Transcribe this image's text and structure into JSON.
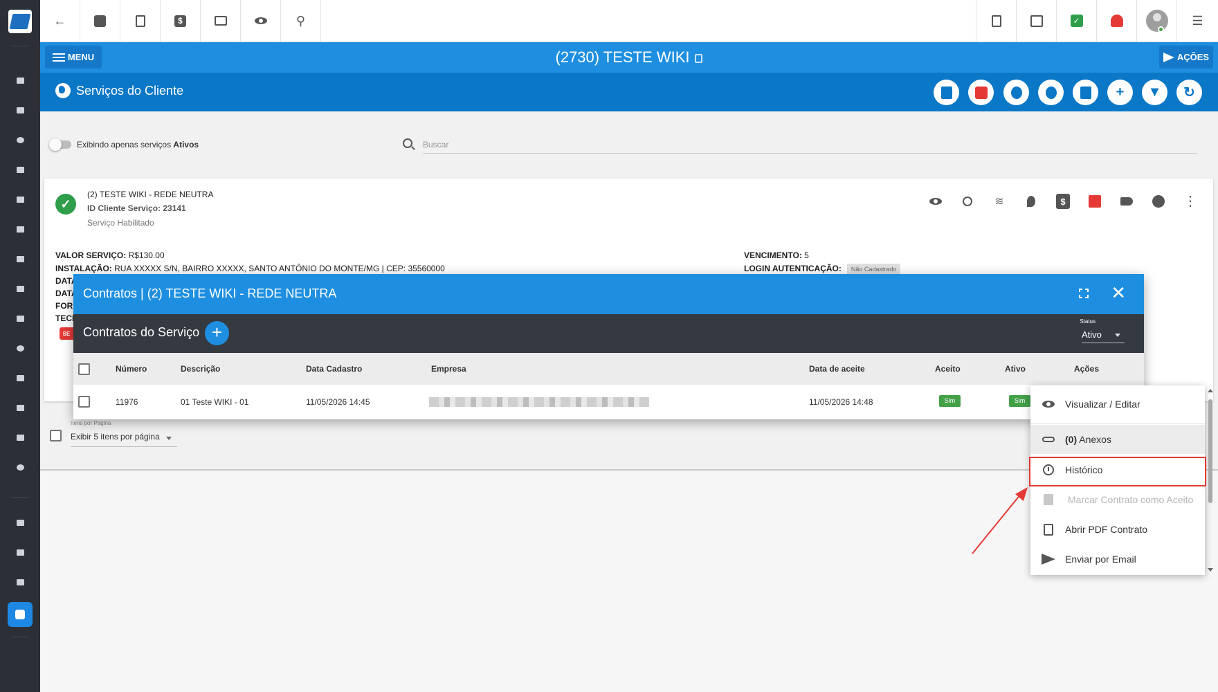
{
  "colors": {
    "sidebar_bg": "#2c3036",
    "primary_blue": "#1e8fe0",
    "dark_blue": "#0a77c7",
    "modal_subheader": "#353a41",
    "success_green": "#43a047",
    "alert_red": "#e53935"
  },
  "sidebar": {
    "icons": [
      "logo-icon",
      "dashboard-icon",
      "flag-icon",
      "chart-icon",
      "contact-icon",
      "book-icon",
      "calendar-icon",
      "briefcase-icon",
      "box-icon",
      "card-icon",
      "map-pin-icon",
      "list-icon",
      "stack-icon",
      "document-icon",
      "gear-icon",
      "youtube-icon",
      "wiki-icon",
      "chat-icon",
      "puzzle-icon"
    ]
  },
  "topbar": {
    "left_icons": [
      "back-arrow-icon",
      "contact-card-icon",
      "calendar-clock-icon",
      "dollar-icon",
      "terminal-icon",
      "eye-icon",
      "search-icon"
    ],
    "right_icons": [
      "pdf-icon",
      "calendar-badge-icon",
      "check-badge-icon",
      "alarm-icon",
      "avatar",
      "list-icon"
    ]
  },
  "header": {
    "menu_label": "MENU",
    "client_title": "(2730) TESTE WIKI",
    "actions_label": "AÇÕES"
  },
  "subheader": {
    "title": "Serviços do Cliente",
    "buttons": [
      "gift-icon",
      "alert-icon",
      "calendar-clock-icon",
      "list-icon",
      "document-icon",
      "add-icon",
      "filter-icon",
      "refresh-icon"
    ]
  },
  "filter": {
    "toggle_label_prefix": "Exibindo apenas serviços ",
    "toggle_label_bold": "Ativos",
    "search_placeholder": "Buscar"
  },
  "service": {
    "name": "(2) TESTE WIKI - REDE NEUTRA",
    "id_line": "ID Cliente Serviço: 23141",
    "status": "Serviço Habilitado",
    "valor_label": "VALOR SERVIÇO:",
    "valor": "R$130.00",
    "instalacao_label": "INSTALAÇÃO:",
    "instalacao": "RUA XXXXX S/N, BAIRRO XXXXX, SANTO ANTÔNIO DO MONTE/MG | CEP: 35560000",
    "vencimento_label": "VENCIMENTO:",
    "vencimento": "5",
    "login_label": "LOGIN AUTENTICAÇÃO:",
    "login_badge": "Não Cadastrado",
    "truncated_labels": [
      "DATA",
      "DATA",
      "FORM",
      "TECN"
    ],
    "red_chip": "SE"
  },
  "pagination": {
    "hint": "Itens por Página",
    "select_value": "Exibir 5 itens por página"
  },
  "modal": {
    "title": "Contratos | (2) TESTE WIKI - REDE NEUTRA",
    "subtitle": "Contratos do Serviço",
    "add_symbol": "+",
    "close_symbol": "✕",
    "status_label": "Status",
    "status_value": "Ativo",
    "columns": [
      "Número",
      "Descrição",
      "Data Cadastro",
      "Empresa",
      "Data de aceite",
      "Aceito",
      "Ativo",
      "Ações"
    ],
    "row": {
      "numero": "11976",
      "descricao": "01 Teste WIKI - 01",
      "data_cadastro": "11/05/2026 14:45",
      "data_aceite": "11/05/2026 14:48",
      "aceito": "Sim",
      "ativo": "Sim"
    }
  },
  "dropdown": {
    "items": [
      {
        "icon": "eye-icon",
        "label": "Visualizar / Editar"
      },
      {
        "icon": "paperclip-icon",
        "count": "(0)",
        "label": "Anexos"
      },
      {
        "icon": "history-icon",
        "label": "Histórico"
      },
      {
        "icon": "bookmark-icon",
        "label": "Marcar Contrato como Aceito"
      },
      {
        "icon": "pdf-icon",
        "label": "Abrir PDF Contrato"
      },
      {
        "icon": "send-icon",
        "label": "Enviar por Email"
      }
    ]
  }
}
